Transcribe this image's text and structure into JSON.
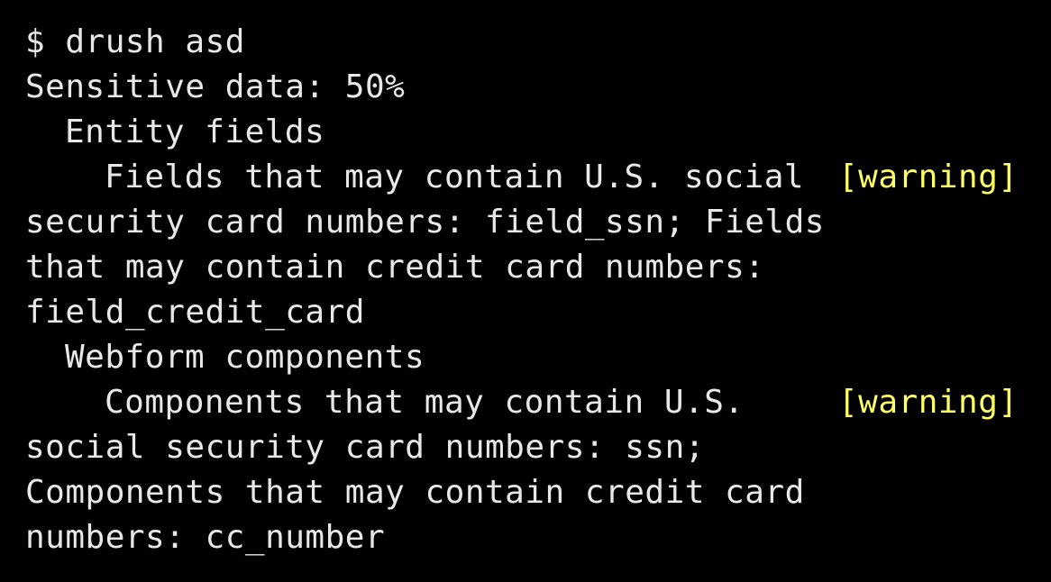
{
  "colors": {
    "background": "#000000",
    "text": "#e8e8e8",
    "warning": "#ffff66"
  },
  "terminal": {
    "command": "$ drush asd",
    "summary": "Sensitive data: 50%",
    "sections": [
      {
        "heading": "Entity fields",
        "message_first_line": "Fields that may contain U.S. social",
        "message_continuation": [
          "security card numbers: field_ssn; Fields",
          "that may contain credit card numbers:",
          "field_credit_card"
        ],
        "status": "[warning]"
      },
      {
        "heading": "Webform components",
        "message_first_line": "Components that may contain U.S.",
        "message_continuation": [
          "social security card numbers: ssn;",
          "Components that may contain credit card",
          "numbers: cc_number"
        ],
        "status": "[warning]"
      }
    ]
  }
}
